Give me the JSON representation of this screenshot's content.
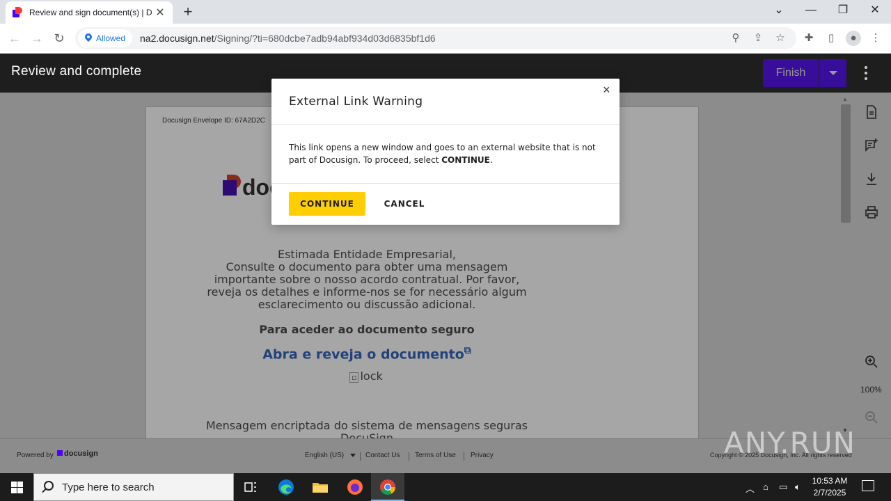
{
  "browser": {
    "tab_title": "Review and sign document(s) | D",
    "tab_close": "✕",
    "new_tab": "+",
    "permission_chip": "Allowed",
    "url_host": "na2.docusign.net",
    "url_path": "/Signing/?ti=680dcbe7adb94abf934d03d6835bf1d6",
    "window_controls": [
      "⌄",
      "—",
      "❐",
      "✕"
    ]
  },
  "header": {
    "title": "Review and complete",
    "finish_label": "Finish"
  },
  "document": {
    "envelope_id": "Docusign Envelope ID: 67A2D2C",
    "logo_text": "doc",
    "body_lines": [
      "Estimada Entidade Empresarial,",
      "Consulte o documento para obter uma mensagem",
      "importante sobre o nosso acordo contratual. Por favor,",
      "reveja os detalhes e informe-nos se for necessário algum",
      "esclarecimento ou discussão adicional."
    ],
    "secure_heading": "Para aceder ao documento seguro",
    "link_text": "Abra e reveja o documento",
    "lock_alt": "lock",
    "footer_lines": [
      "Mensagem encriptada do sistema de mensagens seguras",
      "DocuSign"
    ]
  },
  "rail": {
    "zoom_level": "100%"
  },
  "footer": {
    "powered_by": "Powered by",
    "brand": "docusign",
    "language": "English (US)",
    "contact": "Contact Us",
    "terms": "Terms of Use",
    "privacy": "Privacy",
    "copyright": "Copyright © 2025 Docusign, Inc. All rights reserved"
  },
  "modal": {
    "title": "External Link Warning",
    "close": "×",
    "text_before": "This link opens a new window and goes to an external website that is not part of Docusign. To proceed, select ",
    "text_bold": "CONTINUE",
    "text_after": ".",
    "continue_label": "CONTINUE",
    "cancel_label": "CANCEL"
  },
  "watermark": "ANY.RUN",
  "taskbar": {
    "search_placeholder": "Type here to search",
    "time": "10:53 AM",
    "date": "2/7/2025"
  },
  "colors": {
    "finish": "#4c00ff",
    "continue": "#ffce00",
    "header_bg": "#1e1e1e",
    "link": "#23427a"
  }
}
